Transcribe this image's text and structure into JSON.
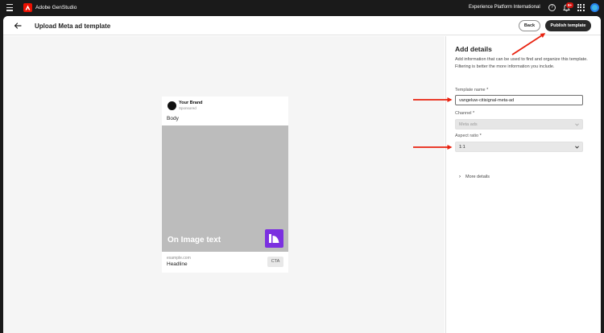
{
  "topnav": {
    "app_name": "Adobe GenStudio",
    "org_name": "Experience Platform International",
    "notification_count": "9+"
  },
  "page": {
    "title": "Upload Meta ad template",
    "back_button": "Back",
    "publish_button": "Publish template"
  },
  "ad_preview": {
    "brand_name": "Your Brand",
    "sponsored": "Sponsored",
    "body": "Body",
    "image_text": "On Image text",
    "url": "example.com",
    "headline": "Headline",
    "cta": "CTA"
  },
  "details_panel": {
    "heading": "Add details",
    "description": "Add information that can be used to find and organize this template. Filtering is better the more information you include.",
    "template_name_label": "Template name",
    "template_name_value": "vangeluw-citisignal-meta-ad",
    "channel_label": "Channel",
    "channel_value": "Meta ads",
    "aspect_ratio_label": "Aspect ratio",
    "aspect_ratio_value": "1:1",
    "required_marker": "*",
    "more_details": "More details"
  },
  "colors": {
    "annotation_arrow": "#e8220f",
    "publish_button_bg": "#292929",
    "image_icon_bg": "#7b30e0",
    "logo_red": "#eb1000"
  }
}
